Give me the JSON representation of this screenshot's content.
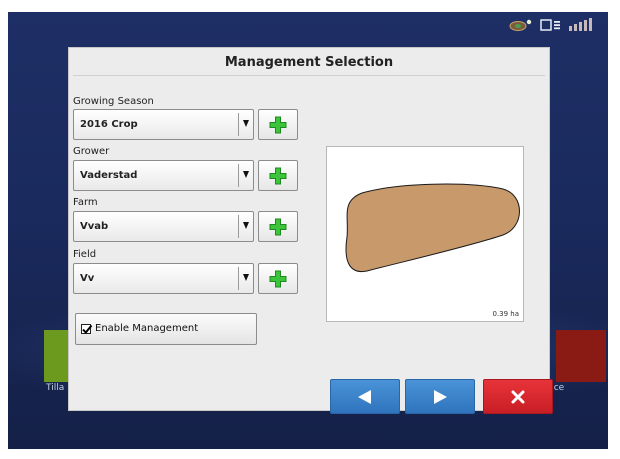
{
  "dialog": {
    "title": "Management Selection"
  },
  "fields": [
    {
      "label": "Growing Season",
      "value": "2016 Crop"
    },
    {
      "label": "Grower",
      "value": "Vaderstad"
    },
    {
      "label": "Farm",
      "value": "Vvab"
    },
    {
      "label": "Field",
      "value": "Vv"
    }
  ],
  "enable_management": {
    "label": "Enable Management",
    "checked": true
  },
  "map": {
    "area_label": "0.39 ha",
    "boundary_fill": "#c8996a",
    "boundary_stroke": "#1a1a1a"
  },
  "background": {
    "left_label": "Tilla",
    "right_label": "lance"
  },
  "icons": {
    "add": "plus-icon",
    "back": "arrow-left-icon",
    "forward": "arrow-right-icon",
    "cancel": "close-icon"
  },
  "colors": {
    "add_icon": "#2fb82f",
    "nav_blue": "#3b84cc",
    "cancel_red": "#d9262d"
  }
}
